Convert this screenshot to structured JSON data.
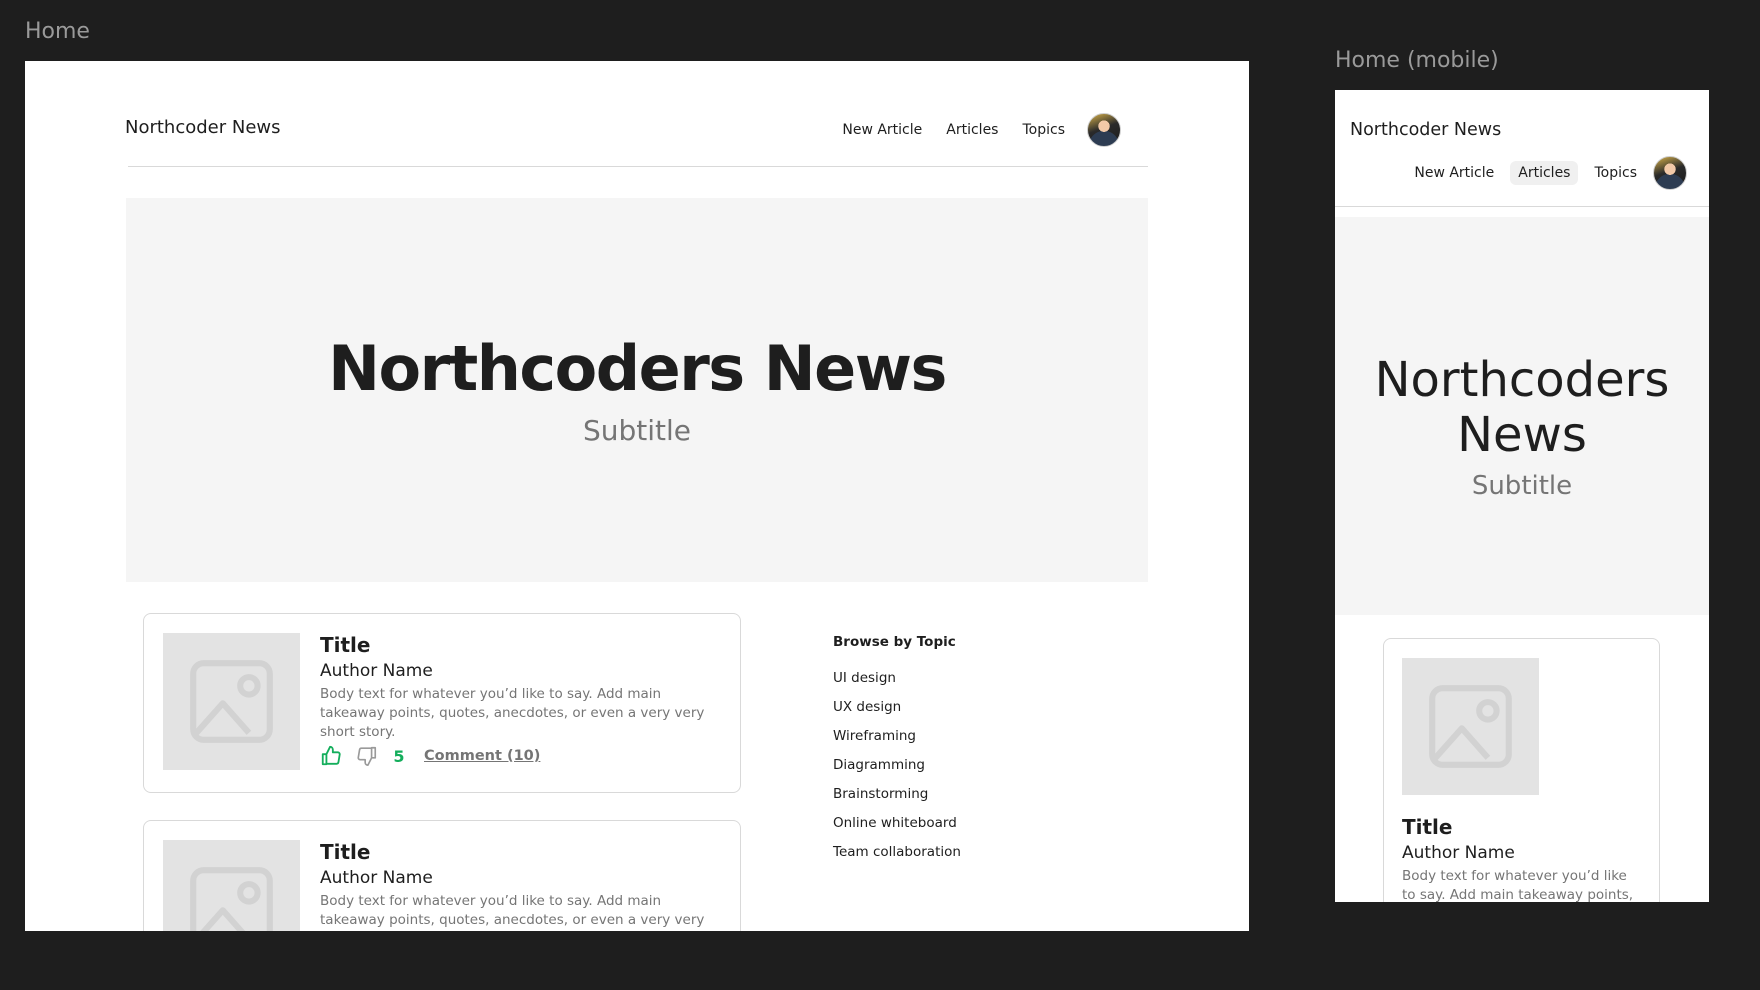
{
  "frames": {
    "desktop_label": "Home",
    "mobile_label": "Home (mobile)"
  },
  "header": {
    "brand": "Northcoder News",
    "nav": [
      {
        "label": "New Article"
      },
      {
        "label": "Articles"
      },
      {
        "label": "Topics"
      }
    ],
    "active_mobile_item": "Articles"
  },
  "hero": {
    "title": "Northcoders News",
    "subtitle": "Subtitle"
  },
  "articles": [
    {
      "title": "Title",
      "author": "Author Name",
      "body": "Body text for whatever you’d like to say. Add main takeaway points, quotes, anecdotes, or even a very very short story.",
      "votes": "5",
      "comment_label": "Comment (10)"
    },
    {
      "title": "Title",
      "author": "Author Name",
      "body": "Body text for whatever you’d like to say. Add main takeaway points, quotes, anecdotes, or even a very very short story."
    }
  ],
  "mobile_article": {
    "title": "Title",
    "author": "Author Name",
    "body": "Body text for whatever you’d like to say. Add main takeaway points,"
  },
  "topics": {
    "heading": "Browse by Topic",
    "items": [
      "UI design",
      "UX design",
      "Wireframing",
      "Diagramming",
      "Brainstorming",
      "Online whiteboard",
      "Team collaboration"
    ]
  },
  "icons": {
    "like": "thumbs-up-icon",
    "dislike": "thumbs-down-icon",
    "image_placeholder": "image-placeholder-icon",
    "avatar": "user-avatar"
  },
  "colors": {
    "canvas": "#1e1e1e",
    "hero_bg": "#f5f5f5",
    "vote_green": "#14ae5c",
    "muted_text": "#757575"
  }
}
